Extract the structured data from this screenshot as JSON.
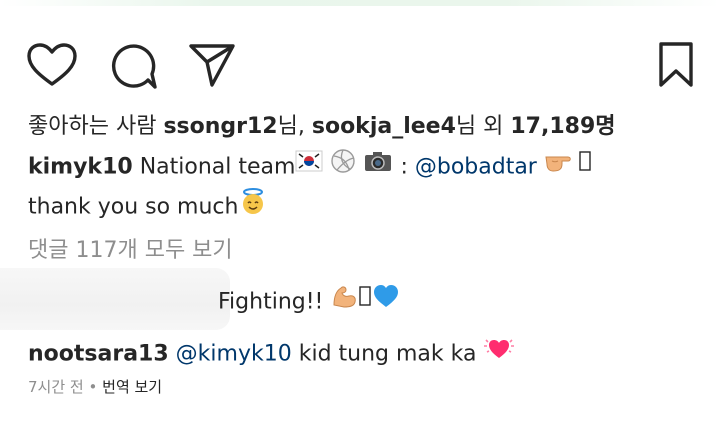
{
  "accent": {
    "link": "#00376b",
    "muted": "#8e8e8e",
    "heart": "#ff2d6f"
  },
  "actions": {
    "like_icon": "heart-outline-icon",
    "comment_icon": "speech-bubble-icon",
    "share_icon": "paper-plane-icon",
    "save_icon": "bookmark-icon"
  },
  "likes": {
    "prefix": "좋아하는 사람",
    "user1": "ssongr12",
    "suffix1": "님, ",
    "user2": "sookja_lee4",
    "suffix2": "님 외 ",
    "count": "17,189",
    "suffix3": "명"
  },
  "caption": {
    "username": "kimyk10",
    "text": "National team",
    "colon": ":",
    "mention": "@bobadtar",
    "line2": "thank you so much"
  },
  "comments_link": "댓글 117개 모두 보기",
  "comment1": {
    "text": "Fighting!!"
  },
  "comment2": {
    "username": "nootsara13",
    "mention": "@kimyk10",
    "text": "kid tung mak ka"
  },
  "footer": {
    "time": "7시간 전",
    "dot": "•",
    "translate": "번역 보기"
  }
}
